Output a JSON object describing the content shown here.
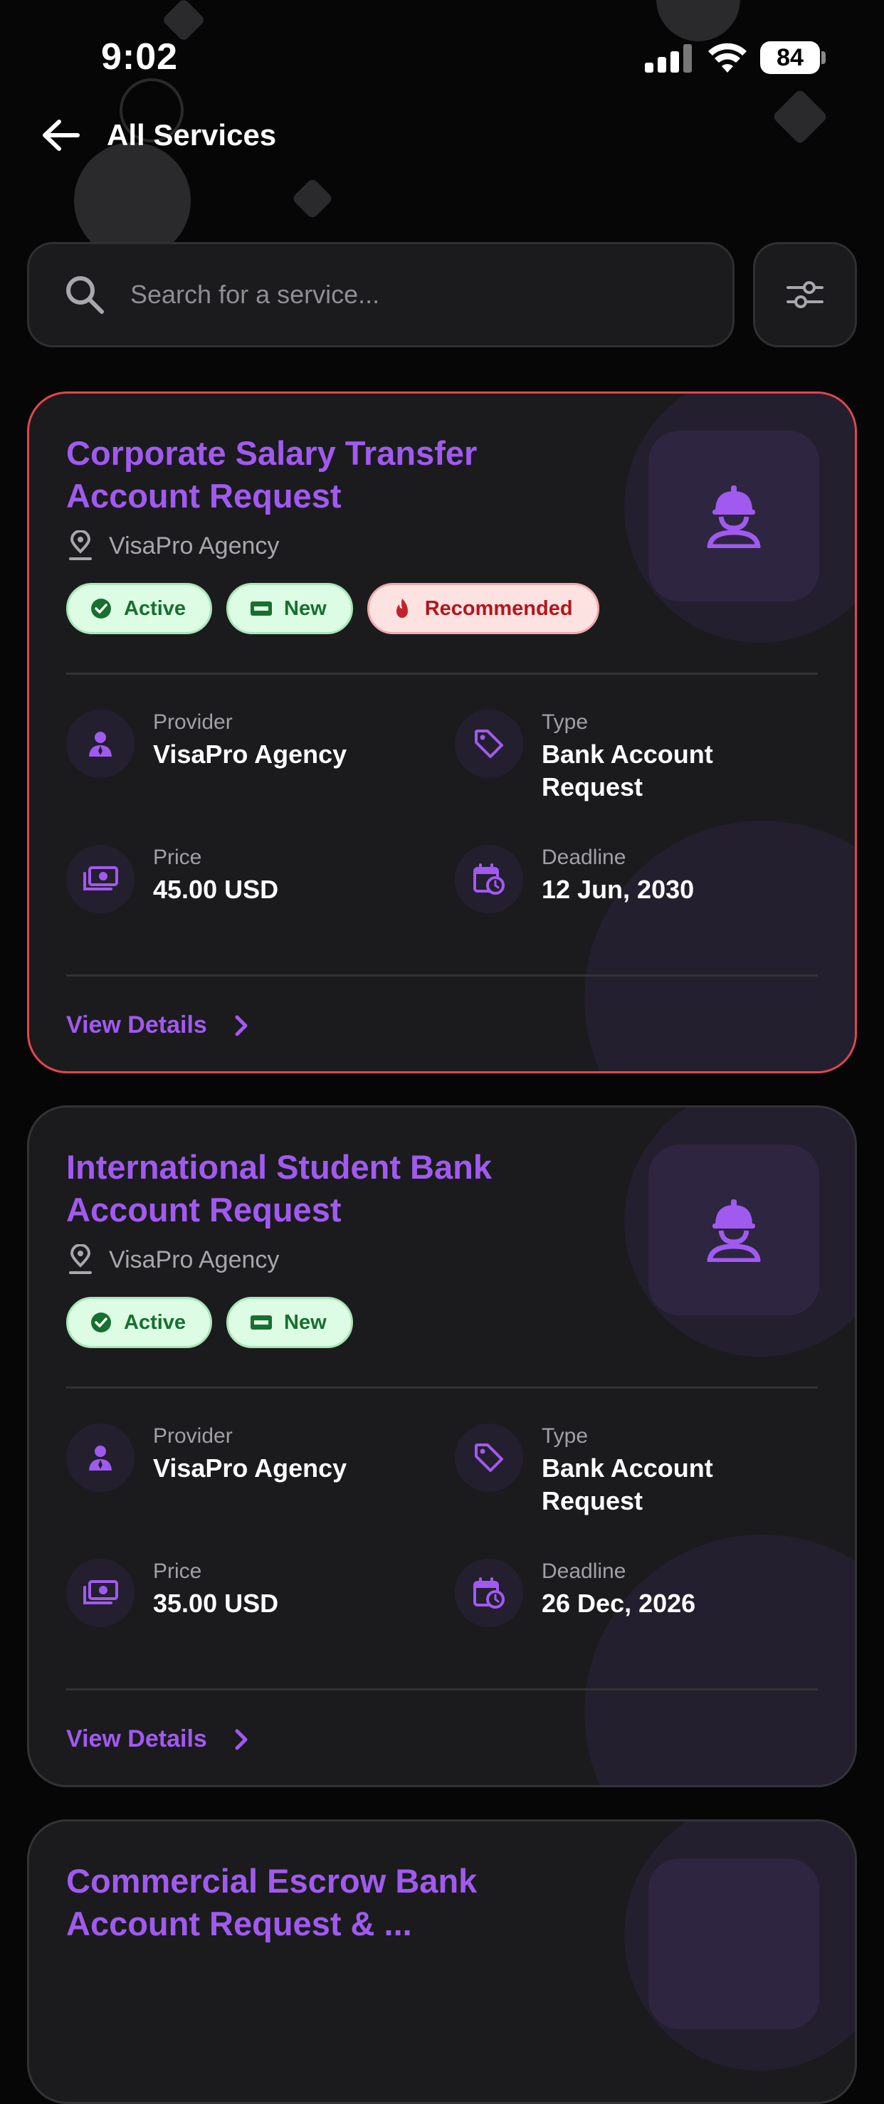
{
  "status_bar": {
    "time": "9:02",
    "battery": "84"
  },
  "header": {
    "title": "All Services"
  },
  "search": {
    "placeholder": "Search for a service..."
  },
  "cards": [
    {
      "title": "Corporate Salary Transfer Account Request",
      "location": "VisaPro Agency",
      "badges": [
        "Active",
        "New",
        "Recommended"
      ],
      "provider_label": "Provider",
      "provider": "VisaPro Agency",
      "type_label": "Type",
      "type": "Bank Account Request",
      "price_label": "Price",
      "price": "45.00 USD",
      "deadline_label": "Deadline",
      "deadline": "12 Jun, 2030",
      "action": "View Details",
      "highlighted": true
    },
    {
      "title": "International Student Bank Account Request",
      "location": "VisaPro Agency",
      "badges": [
        "Active",
        "New"
      ],
      "provider_label": "Provider",
      "provider": "VisaPro Agency",
      "type_label": "Type",
      "type": "Bank Account Request",
      "price_label": "Price",
      "price": "35.00 USD",
      "deadline_label": "Deadline",
      "deadline": "26 Dec, 2026",
      "action": "View Details",
      "highlighted": false
    },
    {
      "title": "Commercial Escrow Bank Account Request & ..."
    }
  ],
  "colors": {
    "accent": "#a15af0",
    "card_bg": "#1b1b1d",
    "highlight_border": "#e0474c",
    "badge_green": "#dcfce3",
    "badge_red": "#fde2e2"
  },
  "icons": {
    "back": "arrow-left-icon",
    "search": "search-icon",
    "filter": "sliders-icon",
    "location": "map-pin-icon",
    "tile": "worker-helmet-icon",
    "provider": "user-tie-icon",
    "type": "tag-icon",
    "price": "cash-icon",
    "deadline": "calendar-clock-icon",
    "chevron": "chevron-right-icon"
  }
}
